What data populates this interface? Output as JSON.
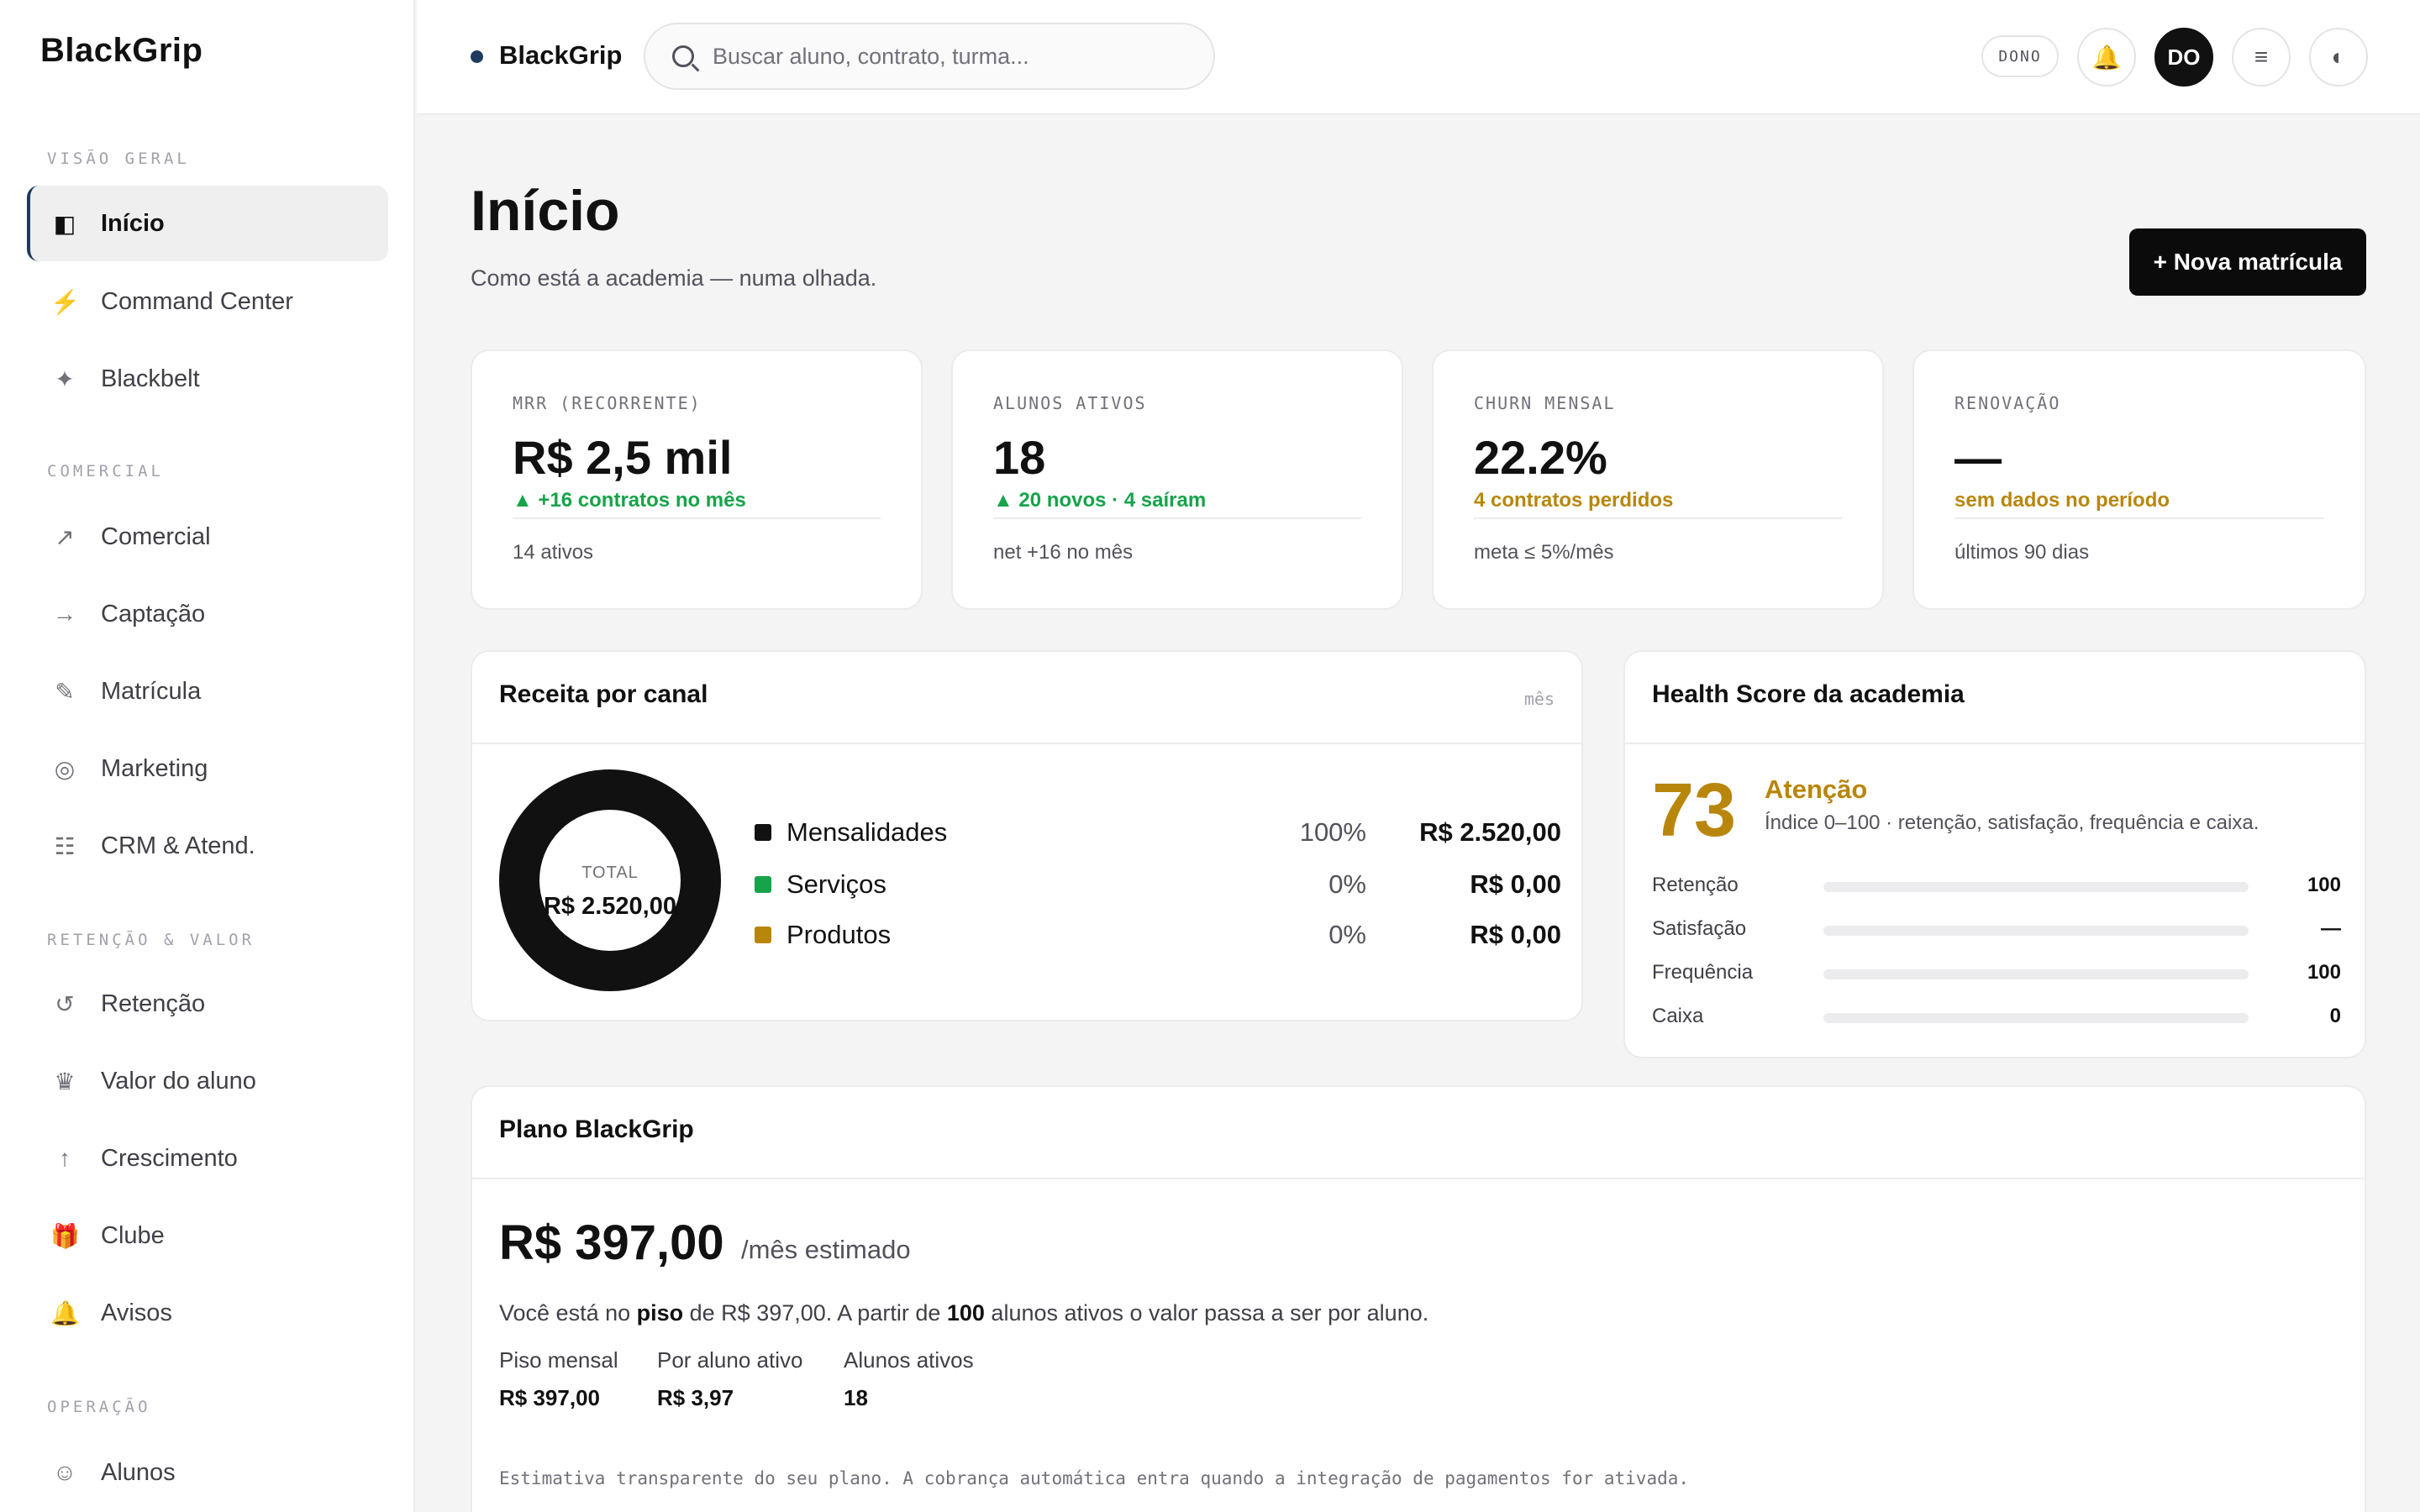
{
  "sidebar": {
    "brand": "BlackGrip",
    "sections": {
      "overview": "VISÃO GERAL",
      "commercial": "COMERCIAL",
      "retention": "RETENÇÃO & VALOR",
      "operation": "OPERAÇÃO"
    },
    "items": [
      {
        "label": "Início",
        "icon": "panel-icon",
        "glyph": "◧"
      },
      {
        "label": "Command Center",
        "icon": "lightning-icon",
        "glyph": "⚡"
      },
      {
        "label": "Blackbelt",
        "icon": "sparkle-icon",
        "glyph": "✦"
      },
      {
        "label": "Comercial",
        "icon": "trend-up-icon",
        "glyph": "↗"
      },
      {
        "label": "Captação",
        "icon": "arrow-right-icon",
        "glyph": "→"
      },
      {
        "label": "Matrícula",
        "icon": "pencil-icon",
        "glyph": "✎"
      },
      {
        "label": "Marketing",
        "icon": "target-icon",
        "glyph": "◎"
      },
      {
        "label": "CRM & Atend.",
        "icon": "list-icon",
        "glyph": "☷"
      },
      {
        "label": "Retenção",
        "icon": "refresh-icon",
        "glyph": "↺"
      },
      {
        "label": "Valor do aluno",
        "icon": "crown-icon",
        "glyph": "♛"
      },
      {
        "label": "Crescimento",
        "icon": "arrow-up-icon",
        "glyph": "↑"
      },
      {
        "label": "Clube",
        "icon": "gift-icon",
        "glyph": "🎁"
      },
      {
        "label": "Avisos",
        "icon": "bell-icon",
        "glyph": "🔔"
      },
      {
        "label": "Alunos",
        "icon": "smiley-icon",
        "glyph": "☺"
      }
    ]
  },
  "topbar": {
    "brand": "BlackGrip",
    "search_placeholder": "Buscar aluno, contrato, turma...",
    "role_badge": "DONO",
    "bell_glyph": "🔔",
    "avatar": "DO",
    "menu_glyph": "≡",
    "theme_glyph": "◐"
  },
  "header": {
    "title": "Início",
    "subtitle": "Como está a academia — numa olhada.",
    "new_enrollment": "+ Nova matrícula"
  },
  "kpis": [
    {
      "label": "MRR (RECORRENTE)",
      "value": "R$ 2,5 mil",
      "delta": "▲ +16 contratos no mês",
      "delta_tone": "green",
      "footer": "14 ativos"
    },
    {
      "label": "ALUNOS ATIVOS",
      "value": "18",
      "delta": "▲ 20 novos · 4 saíram",
      "delta_tone": "green",
      "footer": "net +16 no mês"
    },
    {
      "label": "CHURN MENSAL",
      "value": "22.2%",
      "delta": "4 contratos perdidos",
      "delta_tone": "amber",
      "footer": "meta ≤ 5%/mês"
    },
    {
      "label": "RENOVAÇÃO",
      "value": "—",
      "delta": "sem dados no período",
      "delta_tone": "amber",
      "footer": "últimos 90 dias"
    }
  ],
  "revenue": {
    "title": "Receita por canal",
    "period": "mês",
    "total_label": "TOTAL",
    "total_value": "R$ 2.520,00",
    "channels": [
      {
        "name": "Mensalidades",
        "percent": "100%",
        "amount": "R$ 2.520,00",
        "share": 1.0,
        "color": "#111111"
      },
      {
        "name": "Serviços",
        "percent": "0%",
        "amount": "R$ 0,00",
        "share": 0.0,
        "color": "#16a34a"
      },
      {
        "name": "Produtos",
        "percent": "0%",
        "amount": "R$ 0,00",
        "share": 0.0,
        "color": "#b8860b"
      }
    ]
  },
  "health": {
    "title": "Health Score da academia",
    "score": "73",
    "status": "Atenção",
    "description": "Índice 0–100 · retenção, satisfação, frequência e caixa.",
    "metrics": [
      {
        "name": "Retenção",
        "value": "100",
        "level": 1.0
      },
      {
        "name": "Satisfação",
        "value": "—",
        "level": 0.0
      },
      {
        "name": "Frequência",
        "value": "100",
        "level": 1.0
      },
      {
        "name": "Caixa",
        "value": "0",
        "level": 0.0
      }
    ]
  },
  "plan": {
    "title": "Plano BlackGrip",
    "price": "R$ 397,00",
    "period": "/mês estimado",
    "desc_1": "Você está no ",
    "desc_floor": "piso",
    "desc_2": " de R$ 397,00. A partir de ",
    "desc_count": "100",
    "desc_3": " alunos ativos o valor passa a ser por aluno.",
    "stats": [
      {
        "label": "Piso mensal",
        "value": "R$ 397,00"
      },
      {
        "label": "Por aluno ativo",
        "value": "R$ 3,97"
      },
      {
        "label": "Alunos ativos",
        "value": "18"
      }
    ],
    "note": "Estimativa transparente do seu plano. A cobrança automática entra quando a integração de pagamentos for ativada."
  }
}
